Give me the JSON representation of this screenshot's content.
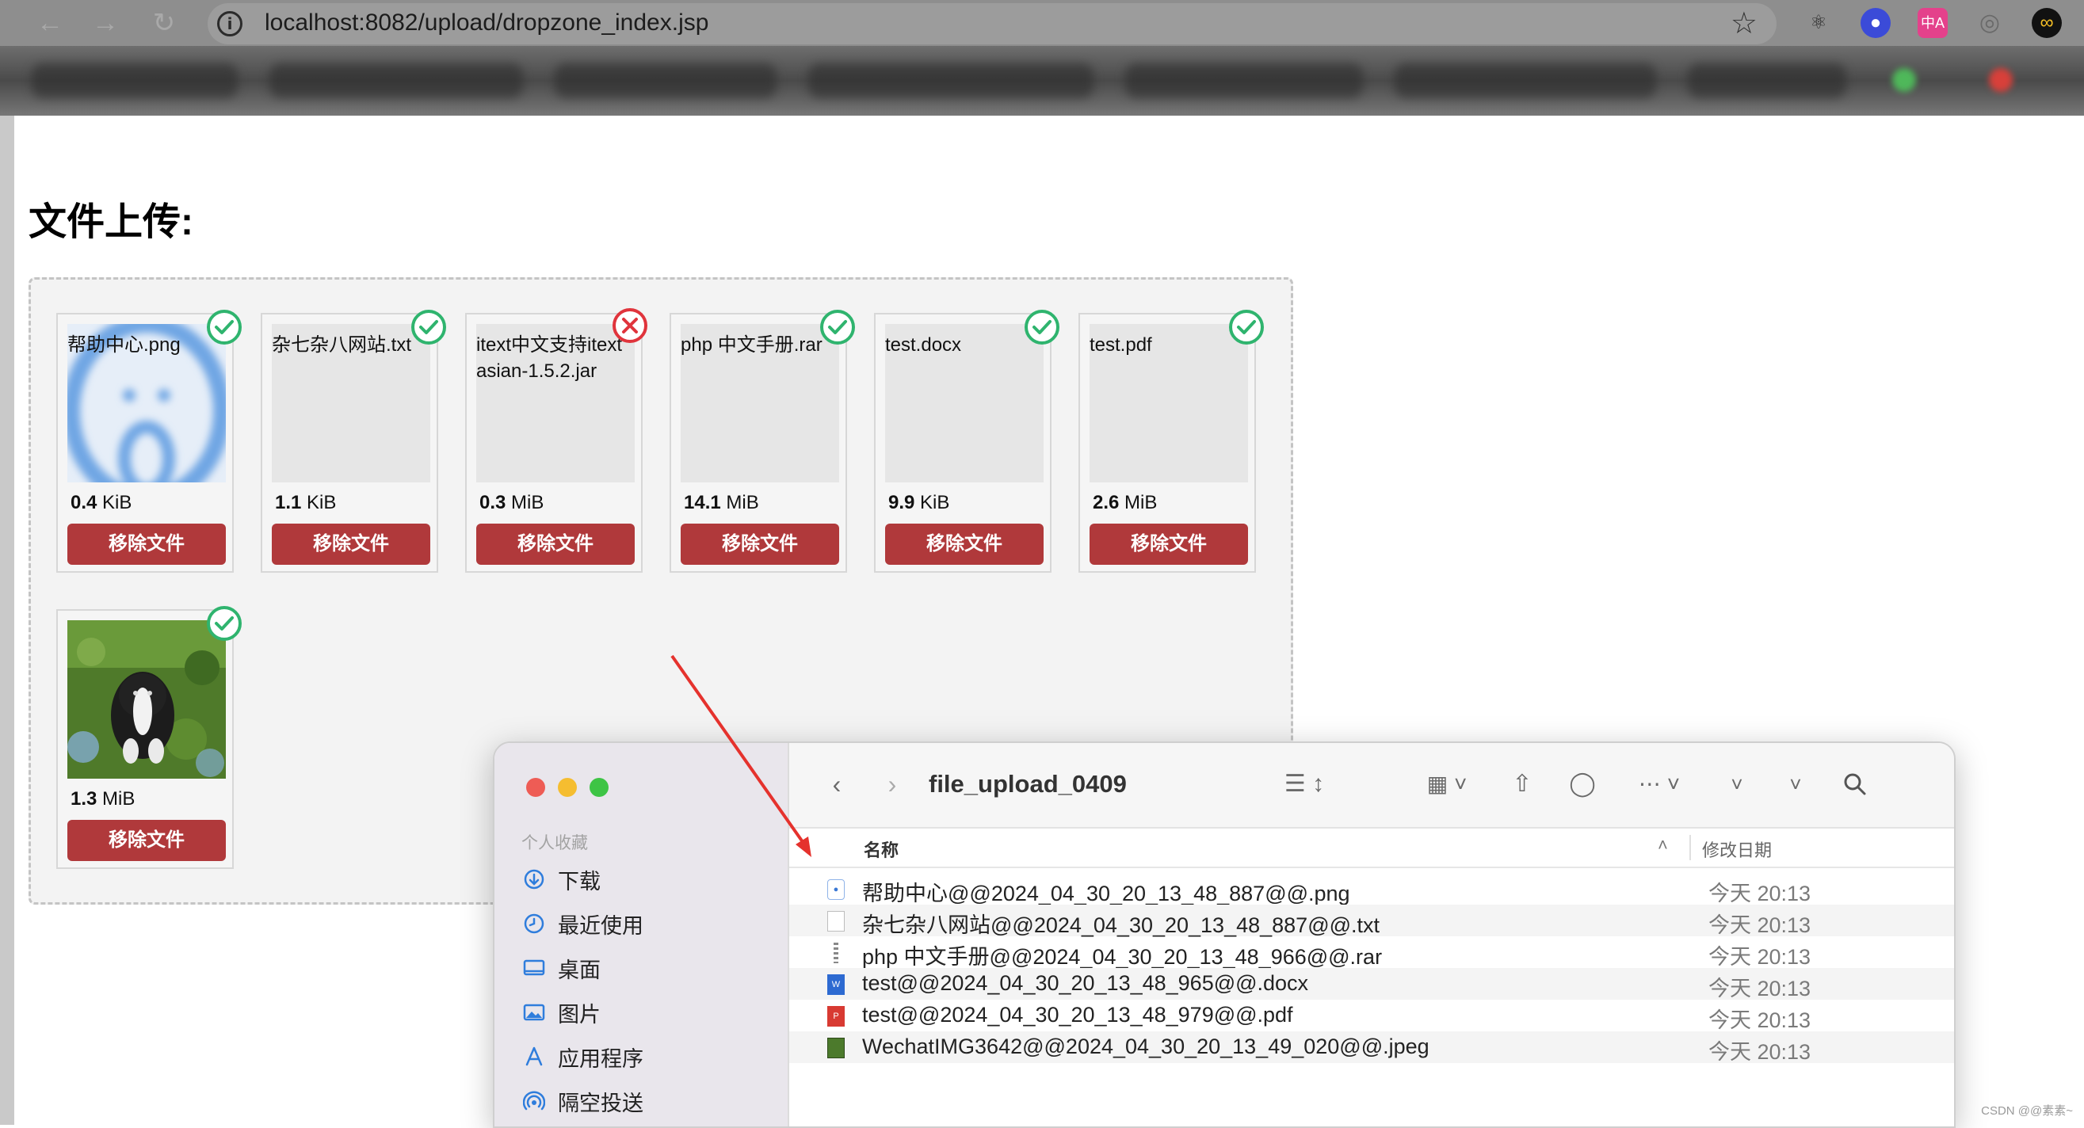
{
  "browser": {
    "url": "localhost:8082/upload/dropzone_index.jsp",
    "back_icon": "arrow-left",
    "forward_icon": "arrow-right",
    "reload_icon": "reload",
    "info_icon": "info",
    "star_icon": "star",
    "extensions": [
      "react-devtools-icon",
      "ghost-extension-icon",
      "translate-extension-icon",
      "record-extension-icon",
      "infinity-extension-icon"
    ],
    "translate_ext_label": "中A"
  },
  "page": {
    "title": "文件上传:"
  },
  "dropzone": {
    "files": [
      {
        "name": "帮助中心.png",
        "size_value": "0.4",
        "size_unit": "KiB",
        "status": "success",
        "remove_label": "移除文件",
        "thumb": "blurry-image"
      },
      {
        "name": "杂七杂八网站.txt",
        "size_value": "1.1",
        "size_unit": "KiB",
        "status": "success",
        "remove_label": "移除文件",
        "thumb": "none"
      },
      {
        "name": "itext中文支持itextasian-1.5.2.jar",
        "size_value": "0.3",
        "size_unit": "MiB",
        "status": "error",
        "remove_label": "移除文件",
        "thumb": "none"
      },
      {
        "name": "php 中文手册.rar",
        "size_value": "14.1",
        "size_unit": "MiB",
        "status": "success",
        "remove_label": "移除文件",
        "thumb": "none"
      },
      {
        "name": "test.docx",
        "size_value": "9.9",
        "size_unit": "KiB",
        "status": "success",
        "remove_label": "移除文件",
        "thumb": "none"
      },
      {
        "name": "test.pdf",
        "size_value": "2.6",
        "size_unit": "MiB",
        "status": "success",
        "remove_label": "移除文件",
        "thumb": "none"
      },
      {
        "name": "",
        "size_value": "1.3",
        "size_unit": "MiB",
        "status": "success",
        "remove_label": "移除文件",
        "thumb": "dog-photo"
      }
    ],
    "success_color": "#2fb46e",
    "error_color": "#e0343c",
    "remove_button_color": "#b0393b"
  },
  "finder": {
    "folder_title": "file_upload_0409",
    "sidebar_heading": "个人收藏",
    "sidebar_items": [
      {
        "label": "下载",
        "icon": "download-icon"
      },
      {
        "label": "最近使用",
        "icon": "clock-icon"
      },
      {
        "label": "桌面",
        "icon": "desktop-icon"
      },
      {
        "label": "图片",
        "icon": "photo-icon"
      },
      {
        "label": "应用程序",
        "icon": "apps-icon"
      },
      {
        "label": "隔空投送",
        "icon": "airdrop-icon"
      }
    ],
    "columns": {
      "name": "名称",
      "date": "修改日期"
    },
    "files": [
      {
        "name": "帮助中心@@2024_04_30_20_13_48_887@@.png",
        "date": "今天 20:13",
        "icon": "png-file-icon"
      },
      {
        "name": "杂七杂八网站@@2024_04_30_20_13_48_887@@.txt",
        "date": "今天 20:13",
        "icon": "txt-file-icon"
      },
      {
        "name": "php 中文手册@@2024_04_30_20_13_48_966@@.rar",
        "date": "今天 20:13",
        "icon": "rar-file-icon"
      },
      {
        "name": "test@@2024_04_30_20_13_48_965@@.docx",
        "date": "今天 20:13",
        "icon": "docx-file-icon"
      },
      {
        "name": "test@@2024_04_30_20_13_48_979@@.pdf",
        "date": "今天 20:13",
        "icon": "pdf-file-icon"
      },
      {
        "name": "WechatIMG3642@@2024_04_30_20_13_49_020@@.jpeg",
        "date": "今天 20:13",
        "icon": "jpeg-file-icon"
      }
    ]
  },
  "annotation": {
    "arrow_color": "#e5322d"
  },
  "watermark": "CSDN @@素素~"
}
